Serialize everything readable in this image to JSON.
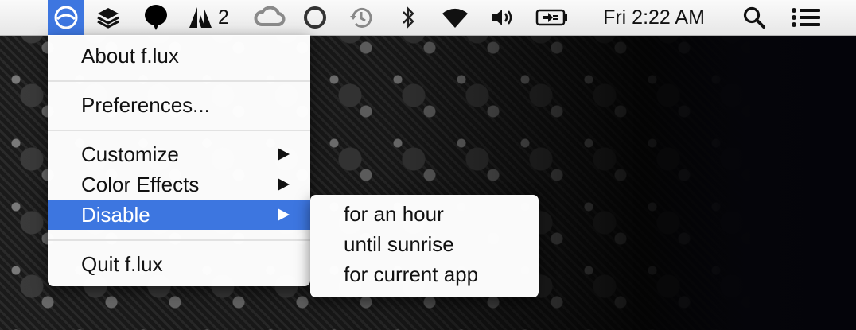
{
  "menubar": {
    "icons": [
      {
        "name": "flux-icon",
        "active": true
      },
      {
        "name": "stacks-icon"
      },
      {
        "name": "speech-bubble-icon"
      },
      {
        "name": "adobe-icon",
        "badge": "2"
      },
      {
        "name": "creative-cloud-icon"
      },
      {
        "name": "circle-app-icon"
      },
      {
        "name": "time-machine-icon"
      },
      {
        "name": "bluetooth-icon"
      },
      {
        "name": "wifi-icon"
      },
      {
        "name": "volume-icon"
      },
      {
        "name": "battery-charging-icon"
      },
      {
        "name": "spotlight-search-icon"
      },
      {
        "name": "notification-center-icon"
      }
    ],
    "adobe_badge": "2",
    "clock": "Fri 2:22 AM",
    "accent_color": "#3d76e0"
  },
  "flux_menu": {
    "items": [
      {
        "label": "About f.lux"
      },
      {
        "label": "Preferences..."
      },
      {
        "label": "Customize",
        "submenu": true
      },
      {
        "label": "Color Effects",
        "submenu": true
      },
      {
        "label": "Disable",
        "submenu": true,
        "selected": true
      },
      {
        "label": "Quit f.lux"
      }
    ]
  },
  "disable_submenu": {
    "items": [
      {
        "label": "for an hour"
      },
      {
        "label": "until sunrise"
      },
      {
        "label": "for current app"
      }
    ]
  }
}
